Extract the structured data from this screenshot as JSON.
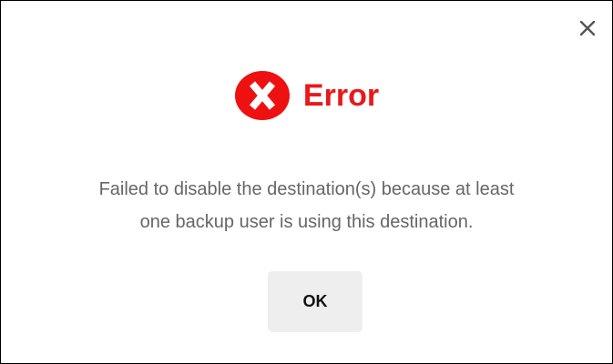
{
  "dialog": {
    "title": "Error",
    "title_color": "#e8191c",
    "icon": "error-x-icon",
    "close_icon": "close-icon",
    "message_lines": [
      "Failed to disable the destination(s) because at least",
      "one backup user is using this destination."
    ],
    "ok_label": "OK",
    "ok_background": "#eeeeee",
    "message_color": "#666666"
  }
}
